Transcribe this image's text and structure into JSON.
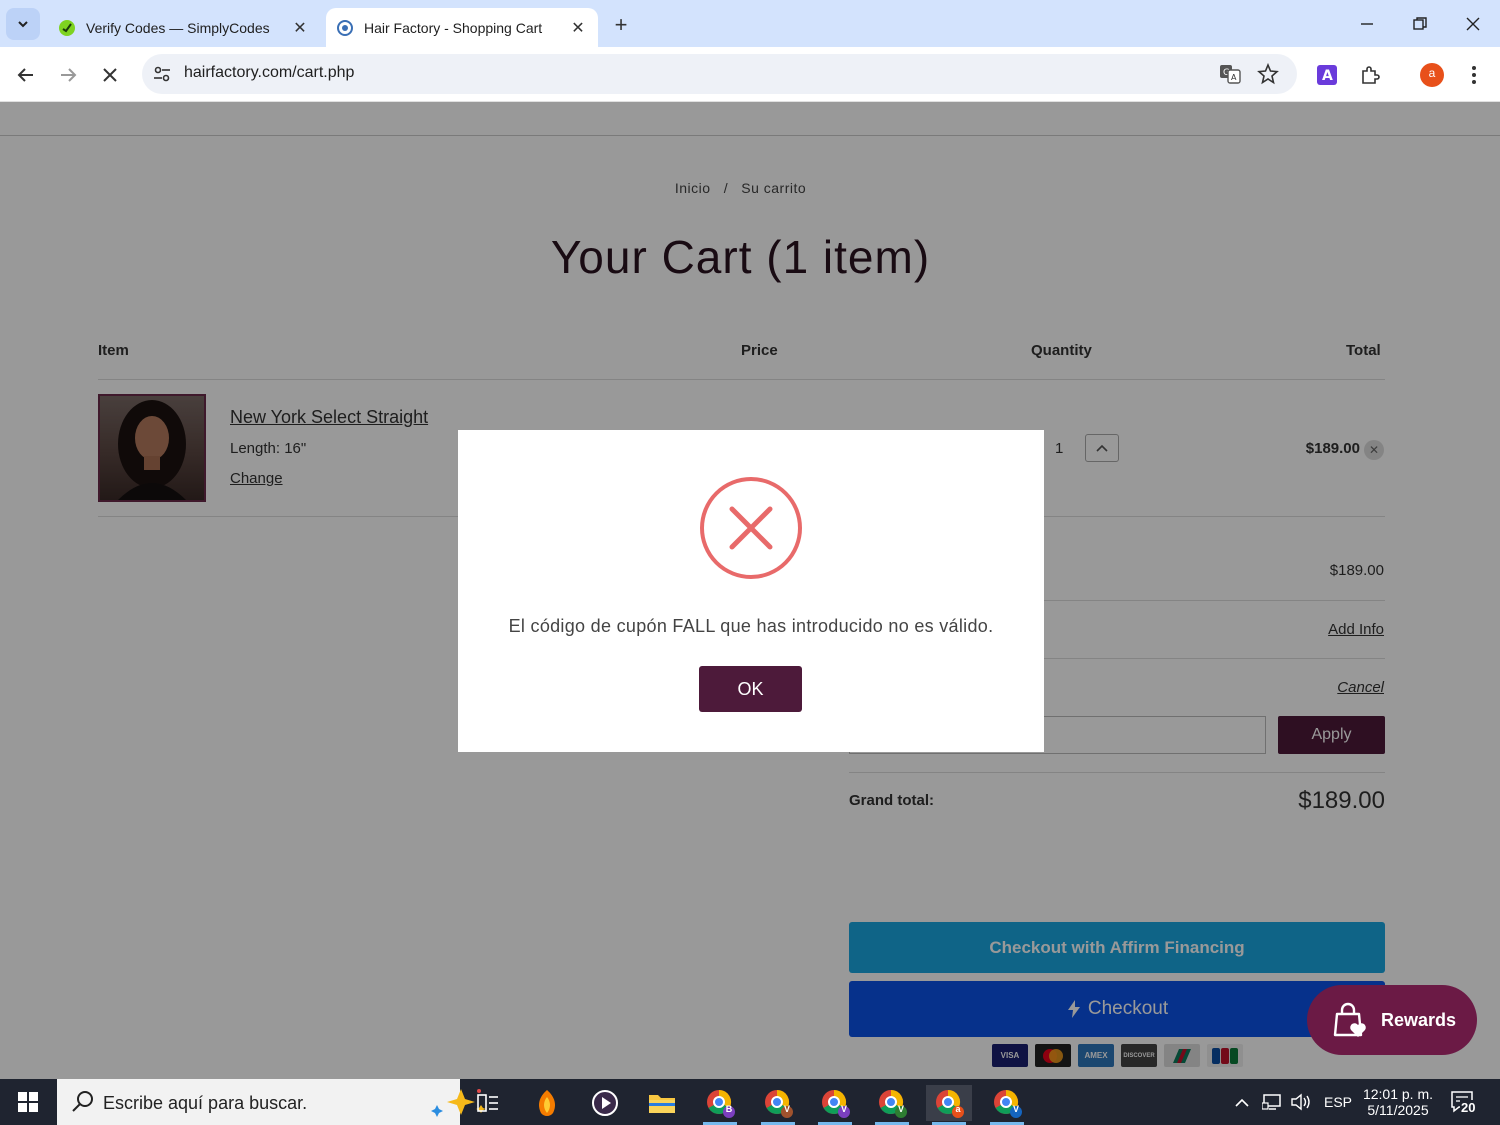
{
  "browser": {
    "tabs": [
      {
        "title": "Verify Codes — SimplyCodes",
        "active": false
      },
      {
        "title": "Hair Factory - Shopping Cart",
        "active": true
      }
    ],
    "url": "hairfactory.com/cart.php",
    "profile_initial": "a"
  },
  "page": {
    "breadcrumb": {
      "home": "Inicio",
      "sep": "/",
      "current": "Su carrito"
    },
    "title": "Your Cart (1 item)",
    "columns": {
      "item": "Item",
      "price": "Price",
      "quantity": "Quantity",
      "total": "Total"
    },
    "item": {
      "name": "New York Select Straight",
      "length": "Length: 16\"",
      "change": "Change",
      "quantity": "1",
      "total": "$189.00"
    },
    "summary": {
      "subtotal_value": "$189.00",
      "add_info": "Add Info",
      "cancel": "Cancel",
      "apply": "Apply",
      "grand_total_label": "Grand total:",
      "grand_total_value": "$189.00"
    },
    "affirm_label": "Checkout with Affirm Financing",
    "checkout_label": "Checkout",
    "payment_cards": [
      "VISA",
      "",
      "AMEX",
      "DISCOVER",
      "",
      ""
    ],
    "rewards_label": "Rewards"
  },
  "modal": {
    "message": "El código de cupón FALL que has introducido no es válido.",
    "ok_label": "OK"
  },
  "taskbar": {
    "search_placeholder": "Escribe aquí para buscar.",
    "language": "ESP",
    "time": "12:01 p. m.",
    "date": "5/11/2025",
    "notification_count": "20",
    "chrome_badges": [
      "B",
      "V",
      "V",
      "V",
      "a",
      "V"
    ]
  },
  "colors": {
    "brand": "#4d1a3a",
    "rewards": "#6b1a45",
    "affirm": "#1aa7e2",
    "checkout": "#0a52e8",
    "error": "#e86a6a"
  }
}
